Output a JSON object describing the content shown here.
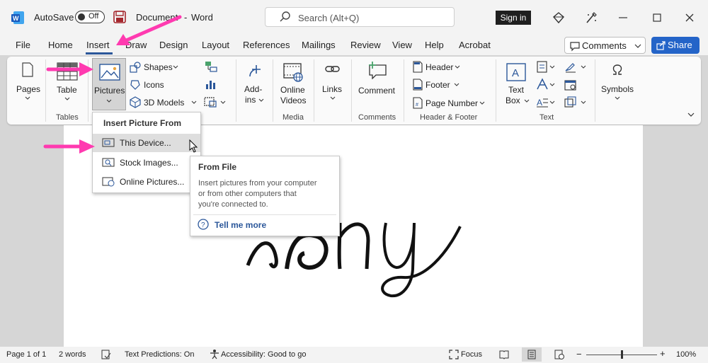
{
  "titlebar": {
    "autosave_label": "AutoSave",
    "autosave_state": "Off",
    "document_name": "Document",
    "app_separator": "-",
    "app_name": "Word",
    "search_placeholder": "Search (Alt+Q)",
    "signin_label": "Sign in"
  },
  "menu": {
    "items": [
      "File",
      "Home",
      "Insert",
      "Draw",
      "Design",
      "Layout",
      "References",
      "Mailings",
      "Review",
      "View",
      "Help",
      "Acrobat"
    ],
    "active": "Insert",
    "comments_label": "Comments",
    "share_label": "Share"
  },
  "ribbon": {
    "pages": "Pages",
    "table": "Table",
    "pictures": "Pictures",
    "shapes": "Shapes",
    "icons": "Icons",
    "models3d": "3D Models",
    "addins_1": "Add-",
    "addins_2": "ins",
    "online_videos_1": "Online",
    "online_videos_2": "Videos",
    "links": "Links",
    "comment": "Comment",
    "header": "Header",
    "footer": "Footer",
    "page_number": "Page Number",
    "textbox_1": "Text",
    "textbox_2": "Box",
    "symbols": "Symbols",
    "groups": {
      "tables": "Tables",
      "media": "Media",
      "comments": "Comments",
      "header_footer": "Header & Footer",
      "text": "Text"
    }
  },
  "dropdown": {
    "title": "Insert Picture From",
    "items": [
      "This Device...",
      "Stock Images...",
      "Online Pictures..."
    ]
  },
  "tooltip": {
    "title": "From File",
    "body_1": "Insert pictures from your computer",
    "body_2": "or from other computers that",
    "body_3": "you're connected to.",
    "link": "Tell me more"
  },
  "statusbar": {
    "page": "Page 1 of 1",
    "words": "2 words",
    "text_predictions": "Text Predictions: On",
    "accessibility": "Accessibility: Good to go",
    "focus": "Focus",
    "zoom": "100%",
    "zoom_level": 1.0
  },
  "colors": {
    "accent": "#2b579a",
    "share": "#2464c8",
    "arrow": "#ff3ab0"
  }
}
